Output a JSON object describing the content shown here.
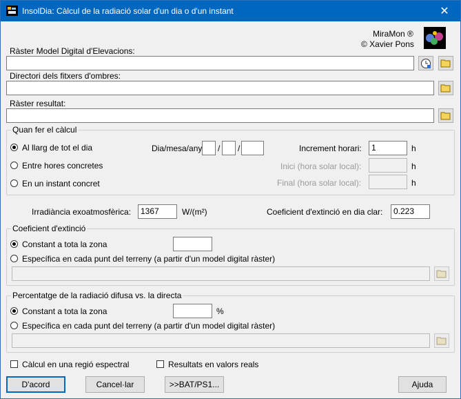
{
  "window": {
    "title": "InsolDia: Càlcul de la radiació solar d'un dia o d'un instant",
    "close_glyph": "✕"
  },
  "brand": {
    "name": "MiraMon ®",
    "author": "© Xavier Pons"
  },
  "fields": {
    "dem_label": "Ràster Model Digital d'Elevacions:",
    "dem_value": "",
    "shadows_label": "Directori dels fitxers d'ombres:",
    "shadows_value": "",
    "result_label": "Ràster resultat:",
    "result_value": ""
  },
  "when": {
    "legend": "Quan fer el càlcul",
    "opt_all_day": "Al llarg de tot el dia",
    "opt_between_hours": "Entre hores concretes",
    "opt_instant": "En un instant concret",
    "date_label": "Dia/mesa/any:",
    "date_sep": "/",
    "day": "",
    "month": "",
    "year": "",
    "increment_label": "Increment horari:",
    "increment_value": "1",
    "increment_unit": "h",
    "start_label": "Inici (hora solar local):",
    "start_unit": "h",
    "end_label": "Final (hora solar local):",
    "end_unit": "h",
    "selected": "all_day"
  },
  "irradiance": {
    "label": "Irradiància exoatmosfèrica:",
    "value": "1367",
    "unit": "W/(m²)"
  },
  "clear_day": {
    "label": "Coeficient d'extinció en dia clar:",
    "value": "0.223"
  },
  "extinction": {
    "legend": "Coeficient d'extinció",
    "opt_constant": "Constant a tota la zona",
    "opt_specific": "Específica en cada punt del terreny (a partir d'un model digital ràster)",
    "constant_value": ""
  },
  "diffuse": {
    "legend": "Percentatge de la radiació difusa vs. la directa",
    "opt_constant": "Constant a tota la zona",
    "opt_specific": "Específica en cada punt del terreny (a partir d'un model digital ràster)",
    "constant_value": "",
    "unit": "%"
  },
  "options": {
    "spectral": "Càlcul en una regió espectral",
    "real_values": "Resultats en valors reals"
  },
  "buttons": {
    "ok": "D'acord",
    "cancel": "Cancel·lar",
    "bat": ">>BAT/PS1...",
    "help": "Ajuda"
  }
}
